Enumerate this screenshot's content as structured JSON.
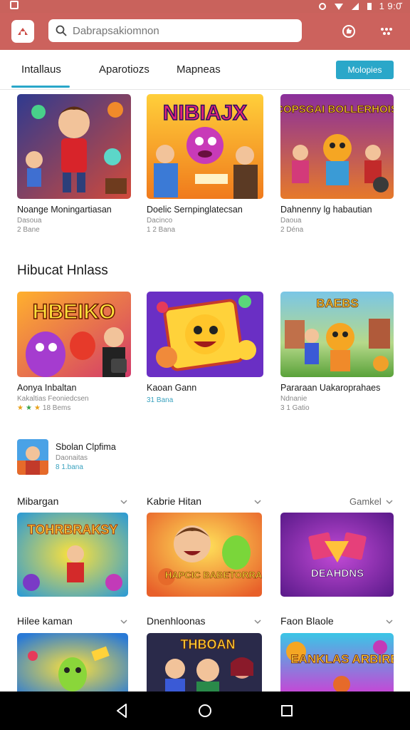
{
  "status": {
    "time": "1 9:0̇̆"
  },
  "search": {
    "placeholder": "Dabrapsakiomnon"
  },
  "tabs": [
    {
      "label": "Intallaus"
    },
    {
      "label": "Aparotiozs"
    },
    {
      "label": "Mapneas"
    }
  ],
  "tab_button": "Molopies",
  "top_cards": [
    {
      "title": "Noange Moningartiasan",
      "sub": "Dasoua",
      "meta": "2 Bane"
    },
    {
      "title": "Doelic Sernpinglatecsan",
      "sub": "Dacinco",
      "meta": "1 2 Bana"
    },
    {
      "title": "Dahnenny lg habautian",
      "sub": "Daoua",
      "meta": "2 Déna"
    }
  ],
  "section": {
    "title": "Hibucat Hnlass"
  },
  "mid_cards": [
    {
      "title": "Aonya Inbaltan",
      "sub": "Kakaltias Feoniedcsen",
      "meta": "18 Bems"
    },
    {
      "title": "Kaoan Gann",
      "sub": "",
      "meta": "31 Bana"
    },
    {
      "title": "Pararaan Uakaroprahaes",
      "sub": "Ndnanie",
      "meta": "3 1 Gatio"
    }
  ],
  "small_card": {
    "title": "Sbolan Clpfima",
    "sub": "Daonaitas",
    "meta": "8 1.bana"
  },
  "row1": {
    "headers": [
      "Mibargan",
      "Kabrie Hitan",
      "Gamkel"
    ],
    "thumb_labels": [
      "TOHRBRAKSY",
      "HAPCIC BABETORRA",
      "DEAHDNS"
    ]
  },
  "row2": {
    "headers": [
      "Hilee kaman",
      "Dnenhloonas",
      "Faon Blaole"
    ],
    "thumb_labels": [
      "",
      "THBOAN",
      "EANKLAS ARBIRE"
    ]
  },
  "top_thumb_labels": [
    "",
    "NIBIAJX",
    "COPSGAI BOLLERHOIS"
  ],
  "mid_thumb_labels": [
    "HBEIKO",
    "",
    "BAEBS"
  ],
  "icons": [
    "app-logo-icon",
    "search-icon",
    "thumbs-icon",
    "dots-icon",
    "back-icon",
    "home-icon",
    "recents-icon"
  ],
  "colors": {
    "header": "#cc625d",
    "accent": "#2aa7c9"
  }
}
